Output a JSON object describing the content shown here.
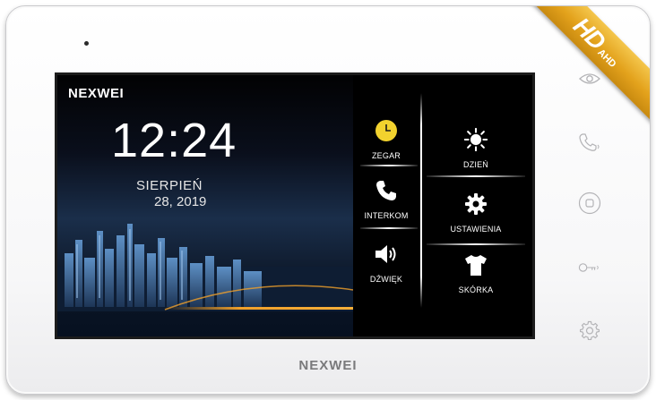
{
  "device": {
    "badge": {
      "hd": "HD",
      "ahd": "AHD"
    },
    "bottom_logo": "NEXWEI"
  },
  "screen": {
    "brand": "NEXWEI",
    "time": "12:24",
    "month": "SIERPIEŃ",
    "date": "28, 2019"
  },
  "menu": {
    "zegar": "ZEGAR",
    "dzien": "DZIEŃ",
    "interkom": "INTERKOM",
    "ustawienia": "USTAWIENIA",
    "dzwiek": "DŹWIĘK",
    "skorka": "SKÓRKA"
  },
  "colors": {
    "accent": "#f0a02a",
    "clock_icon": "#f2d22e",
    "screen_bg": "#000000"
  },
  "icons": [
    "clock-icon",
    "sun-icon",
    "phone-icon",
    "gear-icon",
    "speaker-icon",
    "shirt-icon",
    "eye-icon",
    "call-icon",
    "home-icon",
    "key-icon",
    "settings-icon"
  ]
}
